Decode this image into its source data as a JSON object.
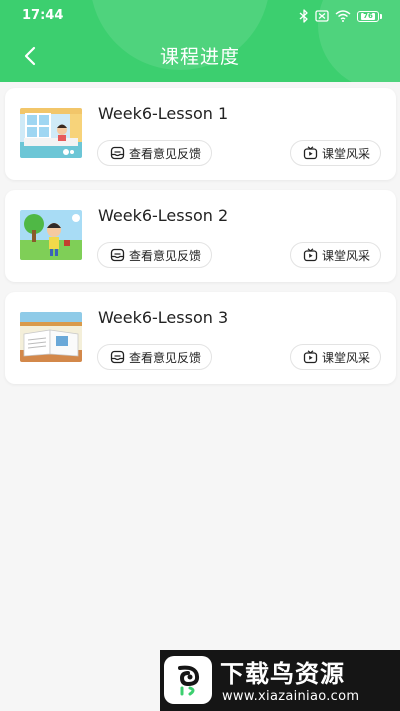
{
  "status_bar": {
    "time": "17:44",
    "battery": "76",
    "icons": [
      "bluetooth-icon",
      "sim-off-icon",
      "wifi-icon",
      "battery-icon"
    ]
  },
  "header": {
    "title": "课程进度",
    "back_icon": "chevron-left-icon",
    "color": "#3ccf6f"
  },
  "lessons": [
    {
      "title": "Week6-Lesson 1",
      "feedback_label": "查看意见反馈",
      "highlights_label": "课堂风采",
      "thumbnail": "classroom-window-scene"
    },
    {
      "title": "Week6-Lesson 2",
      "feedback_label": "查看意见反馈",
      "highlights_label": "课堂风采",
      "thumbnail": "kid-with-tree-scene"
    },
    {
      "title": "Week6-Lesson 3",
      "feedback_label": "查看意见反馈",
      "highlights_label": "课堂风采",
      "thumbnail": "open-book-scene"
    }
  ],
  "watermark": {
    "text": "下载鸟资源",
    "url": "www.xiazainiao.com"
  }
}
